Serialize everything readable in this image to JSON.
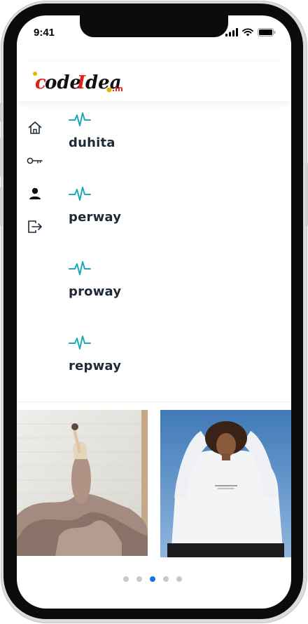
{
  "status_bar": {
    "time": "9:41"
  },
  "header": {
    "logo_text": "codeIdea",
    "logo_suffix": ".in"
  },
  "sidebar": {
    "items": [
      {
        "icon": "home-icon"
      },
      {
        "icon": "key-icon"
      },
      {
        "icon": "user-icon"
      },
      {
        "icon": "logout-icon"
      }
    ]
  },
  "list": {
    "items": [
      {
        "label": "duhita",
        "icon": "pulse-icon"
      },
      {
        "label": "perway",
        "icon": "pulse-icon"
      },
      {
        "label": "proway",
        "icon": "pulse-icon"
      },
      {
        "label": "repway",
        "icon": "pulse-icon"
      }
    ]
  },
  "carousel": {
    "pages": 5,
    "active_page": 3
  },
  "colors": {
    "accent": "#1a73e8",
    "pulse": "#1fa7b8",
    "text": "#1f2a37",
    "logo_red": "#e0201b"
  }
}
